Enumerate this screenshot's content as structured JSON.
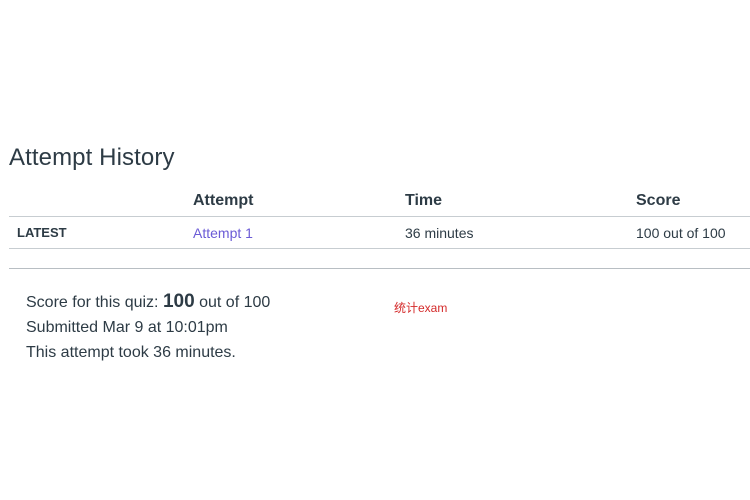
{
  "page": {
    "title": "Attempt History"
  },
  "table": {
    "headers": [
      "",
      "Attempt",
      "Time",
      "Score"
    ],
    "rows": [
      {
        "label": "LATEST",
        "attempt": "Attempt 1",
        "time": "36 minutes",
        "score": "100 out of 100"
      }
    ]
  },
  "summary": {
    "score_prefix": "Score for this quiz: ",
    "score_value": "100",
    "score_suffix": " out of 100",
    "submitted": "Submitted Mar 9 at 10:01pm",
    "duration": "This attempt took 36 minutes."
  },
  "note": {
    "text": "统计exam",
    "color": "#d42a2a"
  },
  "colors": {
    "text": "#2d3b45",
    "link": "#6b5bd6",
    "border": "#c7cdd1"
  }
}
